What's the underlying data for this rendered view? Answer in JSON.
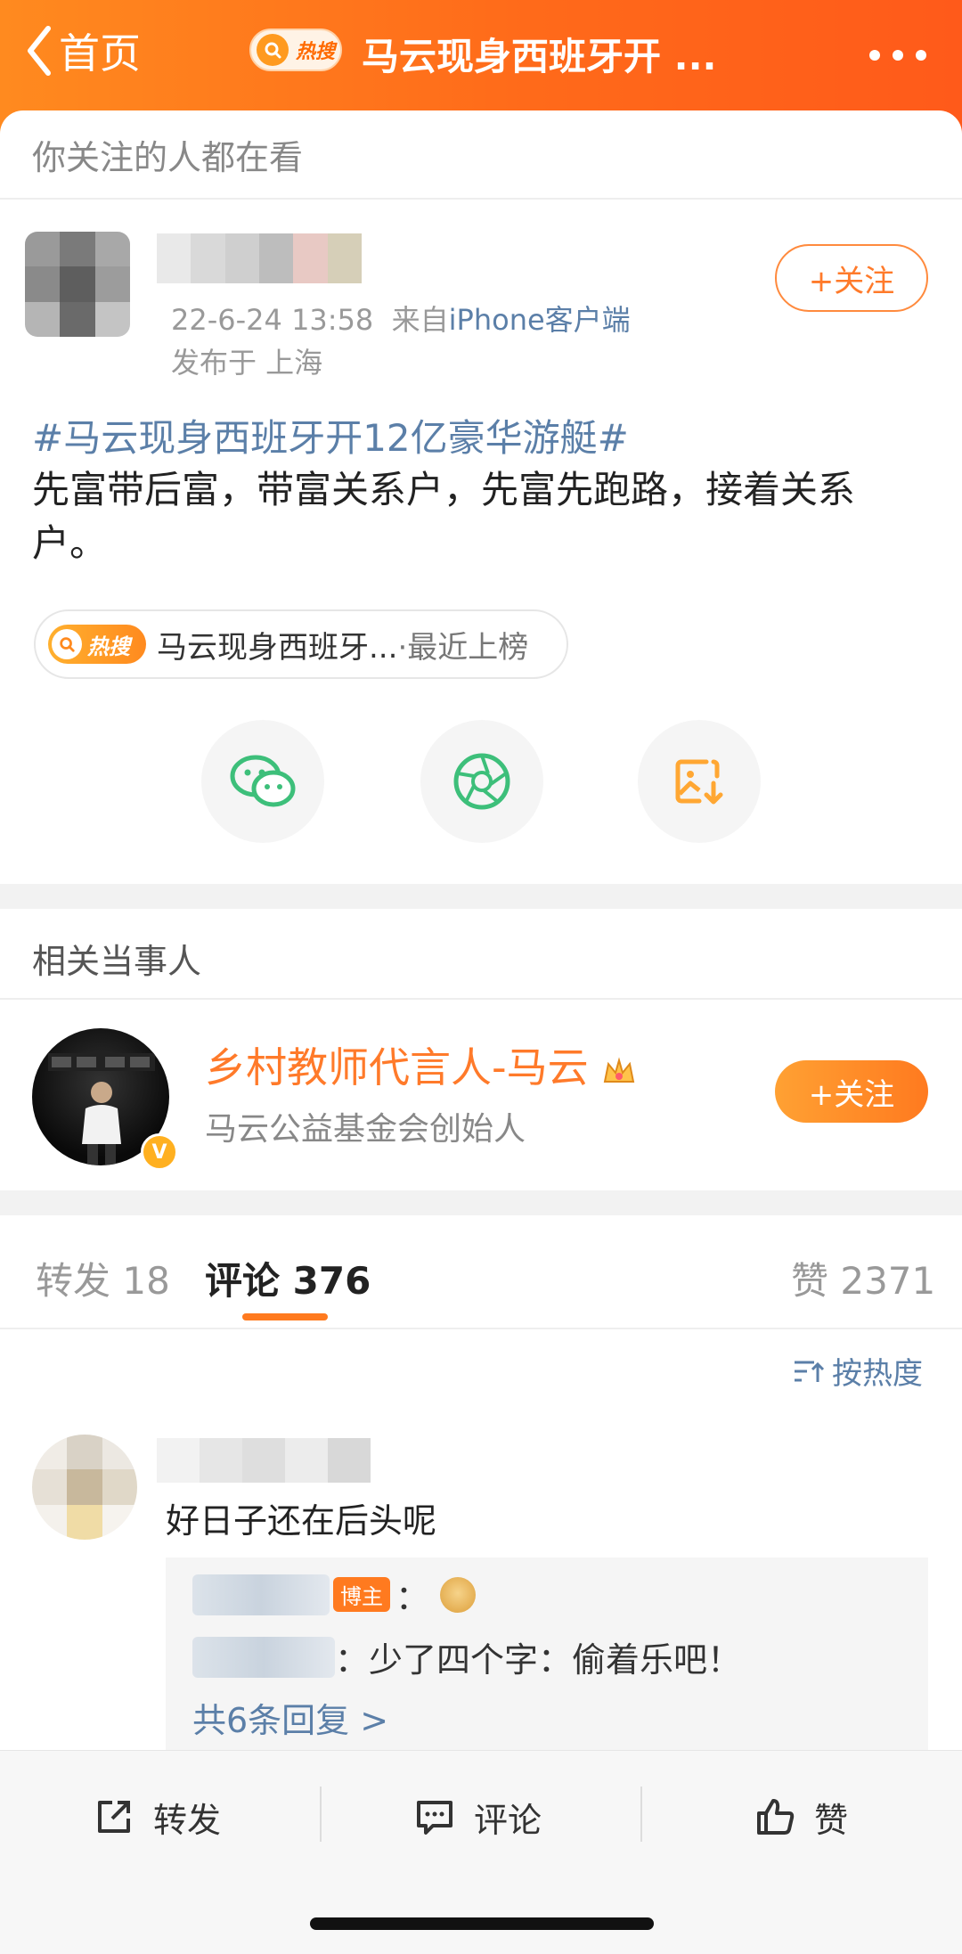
{
  "header": {
    "back_label": "首页",
    "hot_badge": "热搜",
    "title": "马云现身西班牙开 ..."
  },
  "following_section": {
    "header": "你关注的人都在看"
  },
  "post": {
    "time": "22-6-24 13:58",
    "source_prefix": "来自",
    "source": "iPhone客户端",
    "location": "发布于 上海",
    "follow_label": "+关注",
    "hashtag": "#马云现身西班牙开12亿豪华游艇#",
    "text": "先富带后富，带富关系户，先富先跑路，接着关系户。",
    "hot_chip": {
      "badge": "热搜",
      "text": "马云现身西班牙...",
      "suffix": "·最近上榜"
    },
    "share_icons": [
      "wechat-icon",
      "moments-icon",
      "save-image-icon"
    ]
  },
  "related": {
    "header": "相关当事人",
    "name": "乡村教师代言人-马云",
    "description": "马云公益基金会创始人",
    "follow_label": "+关注",
    "verified_mark": "V"
  },
  "tabs": {
    "repost": "转发 18",
    "comment": "评论 376",
    "like": "赞 2371"
  },
  "sort_label": "按热度",
  "comment": {
    "text": "好日子还在后头呢",
    "reply1": {
      "tag": "博主",
      "sep": "："
    },
    "reply2": {
      "text": "：少了四个字：偷着乐吧！"
    },
    "more_replies": "共6条回复 >"
  },
  "bottom_bar": {
    "repost": "转发",
    "comment": "评论",
    "like": "赞"
  },
  "colors": {
    "accent": "#ff7a1f",
    "link": "#5b7fa8"
  }
}
